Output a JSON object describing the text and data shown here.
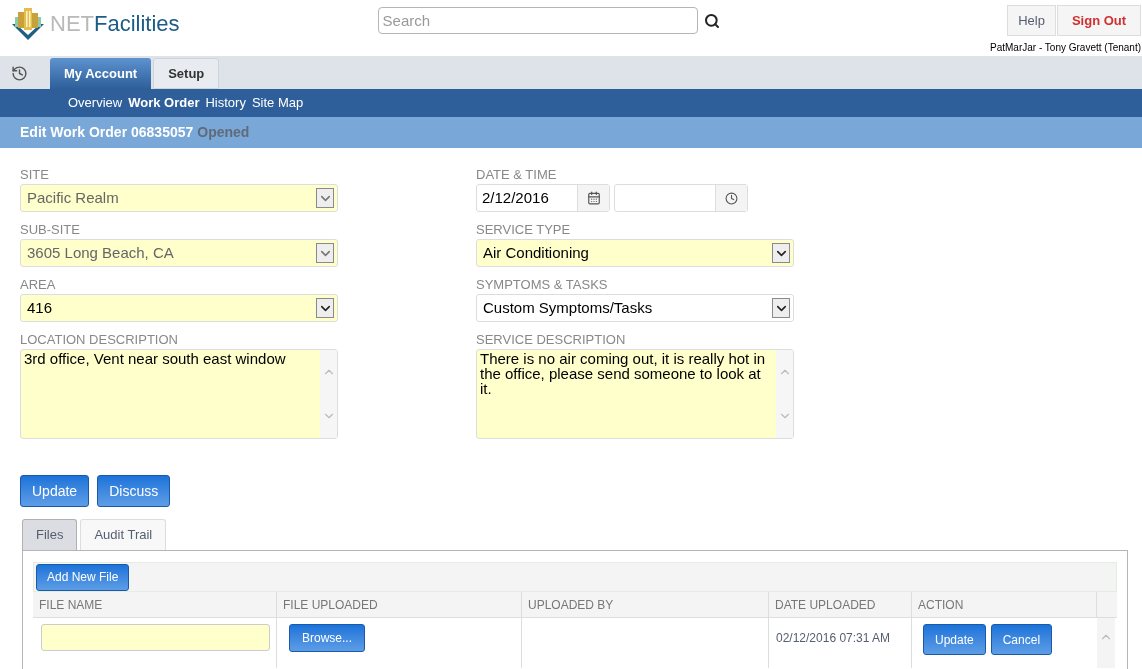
{
  "header": {
    "logo_prefix": "NET",
    "logo_text": "Facilities",
    "search": {
      "placeholder": "Search"
    },
    "buttons": [
      {
        "label": "Help",
        "kind": "plain"
      },
      {
        "label": "Sign Out",
        "kind": "danger"
      }
    ],
    "user": "PatMarJar - Tony Gravett (Tenant)"
  },
  "tabs": [
    {
      "label": "My Account",
      "selected": true
    },
    {
      "label": "Setup",
      "selected": false
    }
  ],
  "subnav": [
    {
      "label": "Overview",
      "selected": false
    },
    {
      "label": "Work Order",
      "selected": true
    },
    {
      "label": "History",
      "selected": false
    },
    {
      "label": "Site Map",
      "selected": false
    }
  ],
  "page_title": {
    "title": "Edit Work Order 06835057",
    "status": "Opened"
  },
  "form": {
    "left": [
      {
        "kind": "select",
        "label": "SITE",
        "value": "Pacific Realm",
        "disabled": true,
        "required": true
      },
      {
        "kind": "select",
        "label": "SUB-SITE",
        "value": "3605 Long Beach, CA",
        "disabled": true,
        "required": true
      },
      {
        "kind": "select",
        "label": "AREA",
        "value": "416",
        "disabled": false,
        "required": true
      },
      {
        "kind": "textarea",
        "label": "LOCATION DESCRIPTION",
        "value": "3rd office, Vent near south east window",
        "disabled": false,
        "required": true
      }
    ],
    "right": [
      {
        "kind": "datetime",
        "label": "DATE & TIME",
        "value": "2/12/2016",
        "disabled": false,
        "required": false
      },
      {
        "kind": "select",
        "label": "SERVICE TYPE",
        "value": "Air Conditioning",
        "disabled": false,
        "required": true
      },
      {
        "kind": "select",
        "label": "SYMPTOMS & TASKS",
        "value": "Custom Symptoms/Tasks",
        "disabled": false,
        "required": false
      },
      {
        "kind": "textarea",
        "label": "SERVICE DESCRIPTION",
        "value": "There is no air coming out, it is really hot in the office, please send someone to look at it.",
        "disabled": false,
        "required": true
      }
    ]
  },
  "actions": [
    "Update",
    "Discuss"
  ],
  "panel_tabs": [
    {
      "label": "Files",
      "selected": true
    },
    {
      "label": "Audit Trail",
      "selected": false
    }
  ],
  "files_table": {
    "toolbar_button": "Add New File",
    "columns": [
      "FILE NAME",
      "FILE UPLOADED",
      "UPLOADED BY",
      "DATE UPLOADED",
      "ACTION"
    ],
    "rows": [
      {
        "browse_button": "Browse...",
        "date_uploaded": "02/12/2016 07:31 AM",
        "actions": [
          "Update",
          "Cancel"
        ]
      }
    ]
  }
}
